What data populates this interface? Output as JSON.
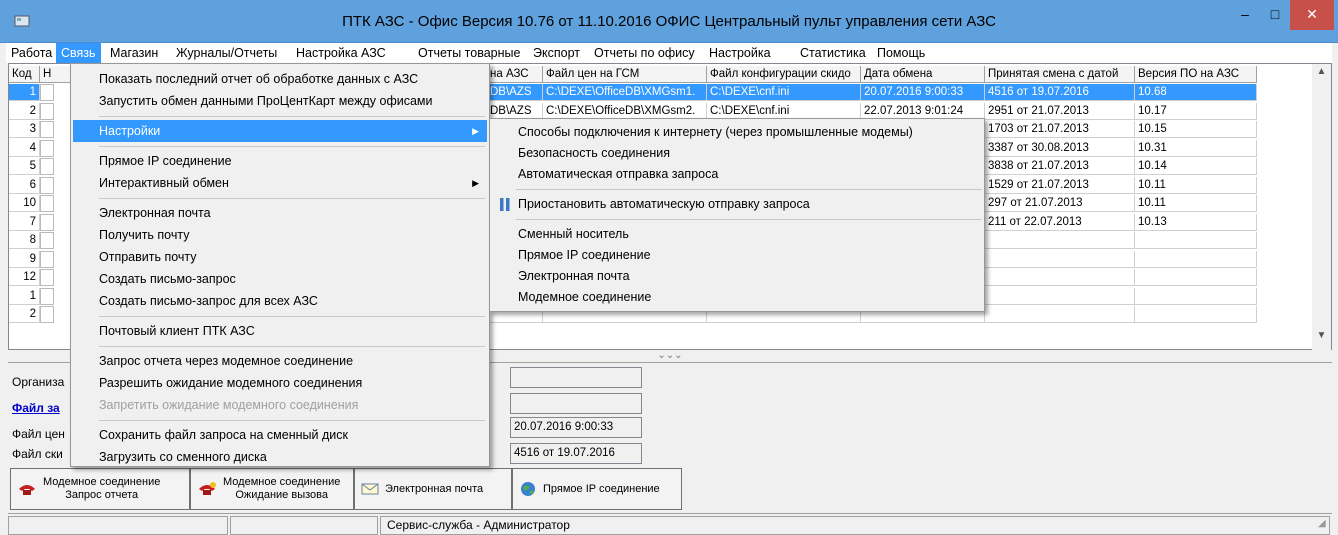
{
  "window": {
    "title": "ПТК АЗС - Офис Версия 10.76 от 11.10.2016 ОФИС Центральный пульт управления сети АЗС",
    "min": "–",
    "max": "□",
    "close": "✕"
  },
  "menubar": [
    "Работа",
    "Связь",
    "Магазин",
    "Журналы/Отчеты",
    "Настройка АЗС",
    "Отчеты товарные",
    "Экспорт",
    "Отчеты по офису",
    "Настройка",
    "Статистика",
    "Помощь"
  ],
  "grid": {
    "headers": [
      "Код",
      "Н",
      "на АЗС",
      "Файл цен на ГСМ",
      "Файл конфигурации скидо",
      "Дата обмена",
      "Принятая смена с датой",
      "Версия ПО на АЗС"
    ],
    "rows": [
      {
        "code": "1",
        "c2": "DB\\AZS",
        "c3": "C:\\DEXE\\OfficeDB\\XMGsm1.",
        "c4": "C:\\DEXE\\cnf.ini",
        "c5": "20.07.2016 9:00:33",
        "c6": "4516 от 19.07.2016",
        "c7": "10.68"
      },
      {
        "code": "2",
        "c2": "DB\\AZS",
        "c3": "C:\\DEXE\\OfficeDB\\XMGsm2.",
        "c4": "C:\\DEXE\\cnf.ini",
        "c5": "22.07.2013 9:01:24",
        "c6": "2951 от 21.07.2013",
        "c7": "10.17"
      },
      {
        "code": "3",
        "c2": "",
        "c3": "",
        "c4": "",
        "c5": "",
        "c6": "1703 от 21.07.2013",
        "c7": "10.15"
      },
      {
        "code": "4",
        "c2": "",
        "c3": "",
        "c4": "",
        "c5": "",
        "c6": "3387 от 30.08.2013",
        "c7": "10.31"
      },
      {
        "code": "5",
        "c2": "",
        "c3": "",
        "c4": "",
        "c5": "",
        "c6": "3838 от 21.07.2013",
        "c7": "10.14"
      },
      {
        "code": "6",
        "c2": "",
        "c3": "",
        "c4": "",
        "c5": "",
        "c6": "1529 от 21.07.2013",
        "c7": "10.11"
      },
      {
        "code": "10",
        "c2": "",
        "c3": "",
        "c4": "",
        "c5": "",
        "c6": "297 от 21.07.2013",
        "c7": "10.11"
      },
      {
        "code": "7",
        "c2": "",
        "c3": "",
        "c4": "",
        "c5": "",
        "c6": "211 от 22.07.2013",
        "c7": "10.13"
      },
      {
        "code": "8",
        "c2": "",
        "c3": "",
        "c4": "",
        "c5": "",
        "c6": "",
        "c7": ""
      },
      {
        "code": "9",
        "c2": "",
        "c3": "",
        "c4": "",
        "c5": "",
        "c6": "",
        "c7": ""
      },
      {
        "code": "12",
        "c2": "",
        "c3": "",
        "c4": "",
        "c5": "",
        "c6": "",
        "c7": ""
      },
      {
        "code": "1",
        "c2": "",
        "c3": "",
        "c4": "",
        "c5": "",
        "c6": "",
        "c7": ""
      },
      {
        "code": "2",
        "c2": "",
        "c3": "",
        "c4": "",
        "c5": "",
        "c6": "",
        "c7": ""
      }
    ]
  },
  "splitter": "⌄⌄⌄",
  "bottom": {
    "labels": [
      "Организа",
      "Файл за",
      "Файл цен",
      "Файл ски"
    ],
    "values": [
      "",
      "",
      "20.07.2016 9:00:33",
      "4516 от 19.07.2016"
    ]
  },
  "toolbar": {
    "b1_line1": "Модемное соединение",
    "b1_line2": "Запрос отчета",
    "b2_line1": "Модемное соединение",
    "b2_line2": "Ожидание вызова",
    "b3": "Электронная почта",
    "b4": "Прямое IP соединение"
  },
  "statusbar": {
    "user": "Сервис-служба - Администратор"
  },
  "menu_sviaz": {
    "items": [
      "Показать последний отчет об обработке данных с АЗС",
      "Запустить обмен данными ПроЦентКарт между офисами",
      "Настройки",
      "Прямое IP соединение",
      "Интерактивный обмен",
      "Электронная почта",
      "Получить почту",
      "Отправить почту",
      "Создать письмо-запрос",
      "Создать письмо-запрос для всех АЗС",
      "Почтовый клиент ПТК АЗС",
      "Запрос отчета через модемное соединение",
      "Разрешить ожидание модемного соединения",
      "Запретить ожидание модемного соединения",
      "Сохранить файл запроса на сменный диск",
      "Загрузить со сменного диска"
    ]
  },
  "menu_settings": {
    "items": [
      "Способы подключения к интернету (через промышленные модемы)",
      "Безопасность соединения",
      "Автоматическая отправка запроса",
      "Приостановить автоматическую отправку запроса",
      "Сменный носитель",
      "Прямое IP соединение",
      "Электронная почта",
      "Модемное соединение"
    ]
  },
  "colors": {
    "highlight": "#3399ff",
    "titlebar": "#5fa1dd",
    "close": "#c7504b"
  }
}
